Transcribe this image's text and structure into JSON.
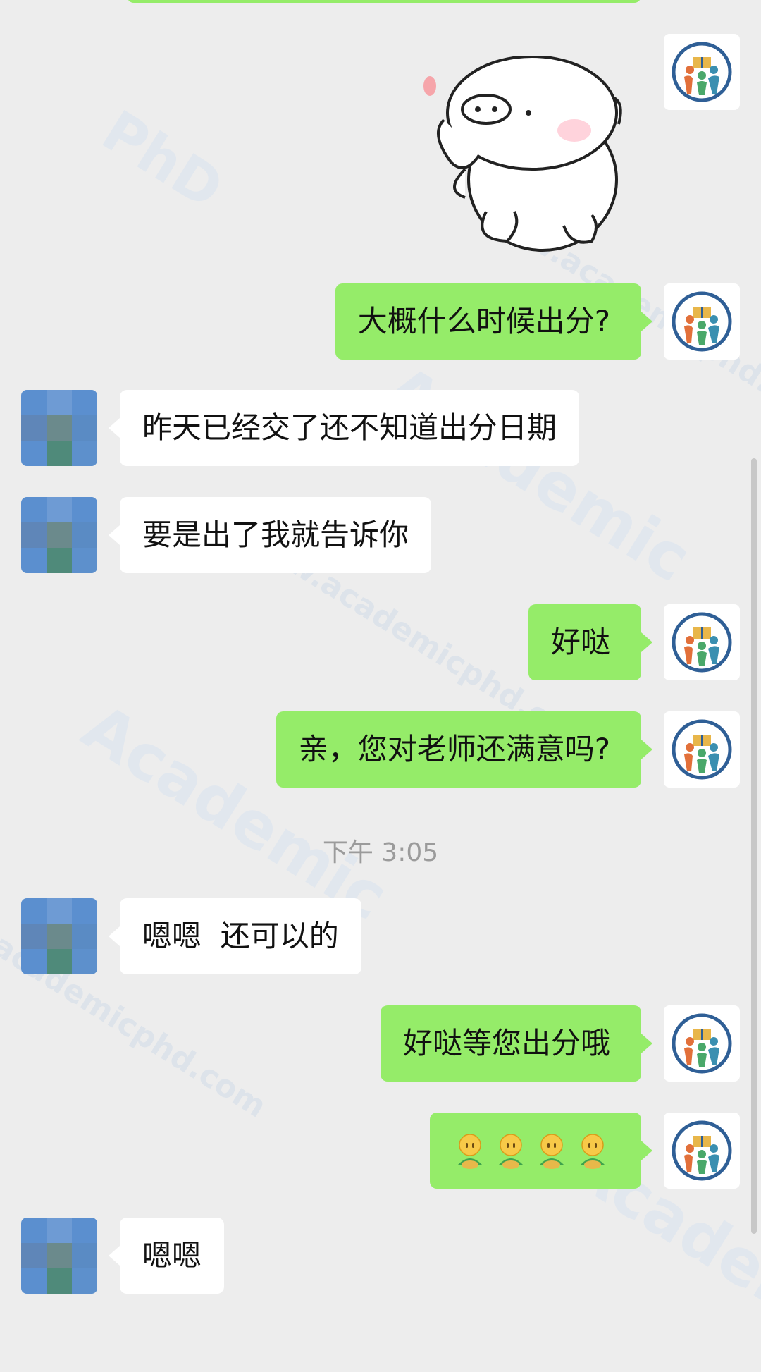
{
  "conversation": {
    "messages": [
      {
        "side": "self",
        "type": "sticker",
        "sticker": "pig-sticker"
      },
      {
        "side": "self",
        "text": "大概什么时候出分?"
      },
      {
        "side": "other",
        "text": "昨天已经交了还不知道出分日期"
      },
      {
        "side": "other",
        "text": "要是出了我就告诉你"
      },
      {
        "side": "self",
        "text": "好哒"
      },
      {
        "side": "self",
        "text": "亲，您对老师还满意吗?"
      },
      {
        "side": "other",
        "text": "嗯嗯  还可以的"
      },
      {
        "side": "self",
        "text": "好哒等您出分哦"
      },
      {
        "side": "self",
        "type": "emoji",
        "emoji": "bow-emoji",
        "count": 4
      },
      {
        "side": "other",
        "text": "嗯嗯"
      }
    ],
    "timestamp": "下午 3:05"
  },
  "watermark": {
    "site": "www.academicphd.com",
    "brand": "Academic",
    "brand2": "PhD",
    "site_short": "academicphd.com"
  },
  "colors": {
    "background": "#ededed",
    "self_bubble": "#95ec69",
    "other_bubble": "#ffffff",
    "timestamp": "#9b9b9b"
  }
}
